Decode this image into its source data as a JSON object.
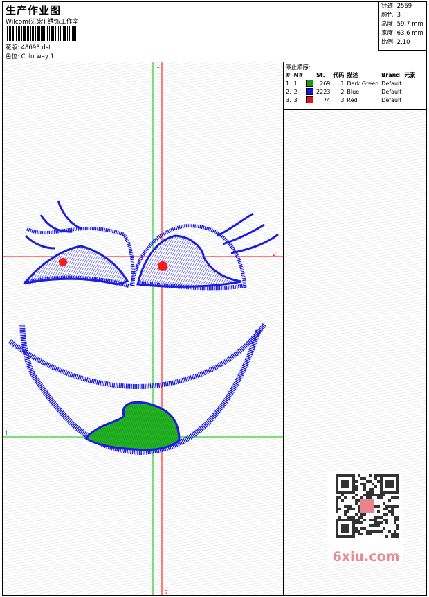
{
  "header": {
    "title": "生产作业图",
    "company": "Wilcom(汇宏) 绣饰工作室",
    "design_label": "花版:",
    "design_file": "48693.dst",
    "colorway_label": "色位:",
    "colorway": "Colorway 1"
  },
  "stats": [
    {
      "label": "针迹:",
      "value": "2569"
    },
    {
      "label": "颜色:",
      "value": "3"
    },
    {
      "label": "高度:",
      "value": "59.7 mm"
    },
    {
      "label": "宽度:",
      "value": "63.6 mm"
    },
    {
      "label": "比例:",
      "value": "2.10"
    }
  ],
  "sequence": {
    "title": "停止顺序:",
    "columns": [
      "#",
      "N#",
      "St.",
      "代码",
      "描述",
      "Brand",
      "元素"
    ],
    "rows": [
      {
        "num": "1.",
        "n": "1",
        "color": "#1a9a1a",
        "st": "269",
        "code": "1",
        "desc": "Dark Green",
        "brand": "Default"
      },
      {
        "num": "2.",
        "n": "2",
        "color": "#1414e6",
        "st": "2223",
        "code": "2",
        "desc": "Blue",
        "brand": "Default"
      },
      {
        "num": "3.",
        "n": "3",
        "color": "#e61414",
        "st": "74",
        "code": "3",
        "desc": "Red",
        "brand": "Default"
      }
    ]
  },
  "axes": {
    "green_v": "1",
    "red_h": "2",
    "green_h": "1",
    "red_v": "2"
  },
  "watermark": "6xiu.com",
  "colors": {
    "thread_blue": "#1c1ce0",
    "thread_green": "#22b322",
    "thread_red": "#ff1a1a",
    "guide_red": "#ff0000",
    "guide_green": "#00c000"
  }
}
